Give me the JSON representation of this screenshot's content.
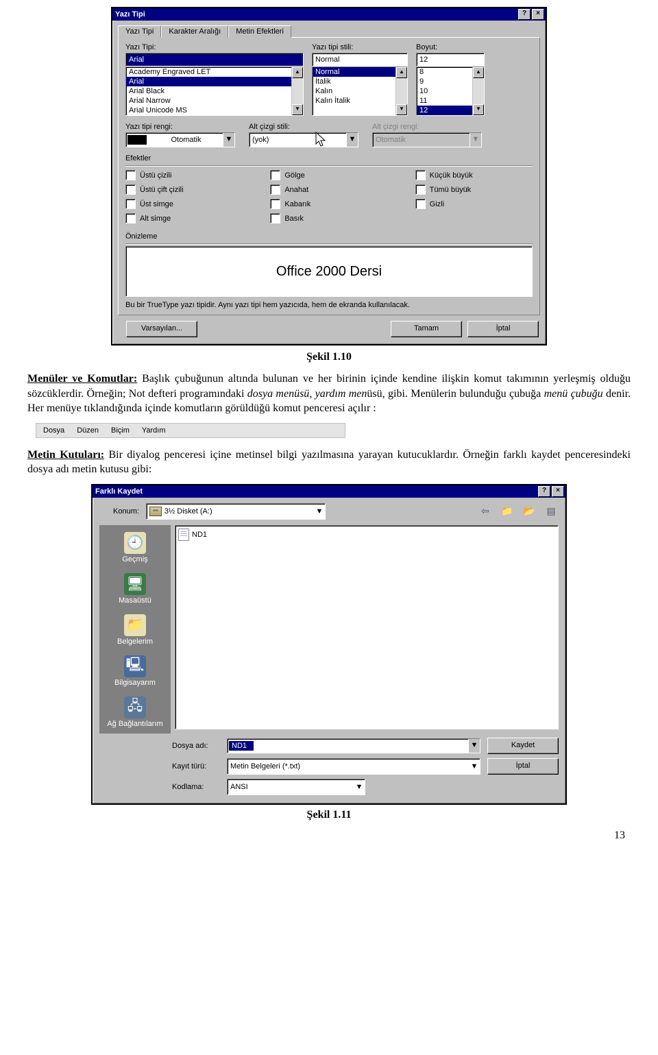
{
  "font_dialog": {
    "title": "Yazı Tipi",
    "help_btn": "?",
    "close_btn": "×",
    "tabs": {
      "font": "Yazı Tipi",
      "char_spacing": "Karakter Aralığı",
      "text_effects": "Metin Efektleri"
    },
    "labels": {
      "font": "Yazı Tipi:",
      "style": "Yazı tipi stili:",
      "size": "Boyut:",
      "color": "Yazı tipi rengi:",
      "underline": "Alt çizgi stili:",
      "line_color": "Alt çizgi rengi:",
      "effects": "Efektler",
      "preview": "Önizleme"
    },
    "font_input": "Arial",
    "font_list": [
      "Academy Engraved LET",
      "Arial",
      "Arial Black",
      "Arial Narrow",
      "Arial Unicode MS"
    ],
    "font_selected_index": 1,
    "style_input": "Normal",
    "style_list": [
      "Normal",
      "İtalik",
      "Kalın",
      "Kalın İtalik"
    ],
    "style_selected_index": 0,
    "size_input": "12",
    "size_list": [
      "8",
      "9",
      "10",
      "11",
      "12"
    ],
    "size_selected_index": 4,
    "color_value": "Otomatik",
    "underline_value": "(yok)",
    "line_color_value": "Otomatik",
    "effects": {
      "strike": "Üstü çizili",
      "dstrike": "Üstü çift çizili",
      "super": "Üst simge",
      "sub": "Alt simge",
      "shadow": "Gölge",
      "outline": "Anahat",
      "emboss": "Kabarık",
      "engrave": "Basık",
      "smallcaps": "Küçük büyük",
      "allcaps": "Tümü büyük",
      "hidden": "Gizli"
    },
    "preview_text": "Office 2000 Dersi",
    "info": "Bu bir TrueType yazı tipidir. Aynı yazı tipi hem yazıcıda, hem de ekranda kullanılacak.",
    "buttons": {
      "default": "Varsayılan...",
      "ok": "Tamam",
      "cancel": "İptal"
    }
  },
  "caption1": "Şekil 1.10",
  "para1": {
    "topic": "Menüler ve Komutlar:",
    "text": " Başlık çubuğunun altında bulunan ve her birinin içinde kendine ilişkin komut takımının yerleşmiş olduğu sözcüklerdir. Örneğin; Not defteri programındaki ",
    "i1": "dosya menüsü",
    "mid1": ", ",
    "i2": "yardım men",
    "mid2": "üsü, gibi. Menülerin bulunduğu çubuğa ",
    "i3": "menü çubuğu",
    "tail": " denir. Her menüye tıklandığında içinde komutların görüldüğü komut penceresi açılır :"
  },
  "menubar": {
    "file": "Dosya",
    "edit": "Düzen",
    "format": "Biçim",
    "help": "Yardım"
  },
  "para2": {
    "topic": "Metin Kutuları:",
    "text": " Bir diyalog penceresi içine metinsel bilgi yazılmasına yarayan kutucuklardır. Örneğin farklı kaydet penceresindeki dosya adı metin kutusu gibi:"
  },
  "save_dialog": {
    "title": "Farklı Kaydet",
    "help_btn": "?",
    "close_btn": "×",
    "location_label": "Konum:",
    "location_value": "3½ Disket (A:)",
    "places": {
      "history": "Geçmiş",
      "desktop": "Masaüstü",
      "docs": "Belgelerim",
      "computer": "Bilgisayarım",
      "network": "Ağ Bağlantılarım"
    },
    "file_in_list": "ND1",
    "filename_label": "Dosya adı:",
    "filename_value": "ND1",
    "type_label": "Kayıt türü:",
    "type_value": "Metin Belgeleri (*.txt)",
    "encoding_label": "Kodlama:",
    "encoding_value": "ANSI",
    "buttons": {
      "save": "Kaydet",
      "cancel": "İptal"
    }
  },
  "caption2": "Şekil 1.11",
  "page_num": "13"
}
